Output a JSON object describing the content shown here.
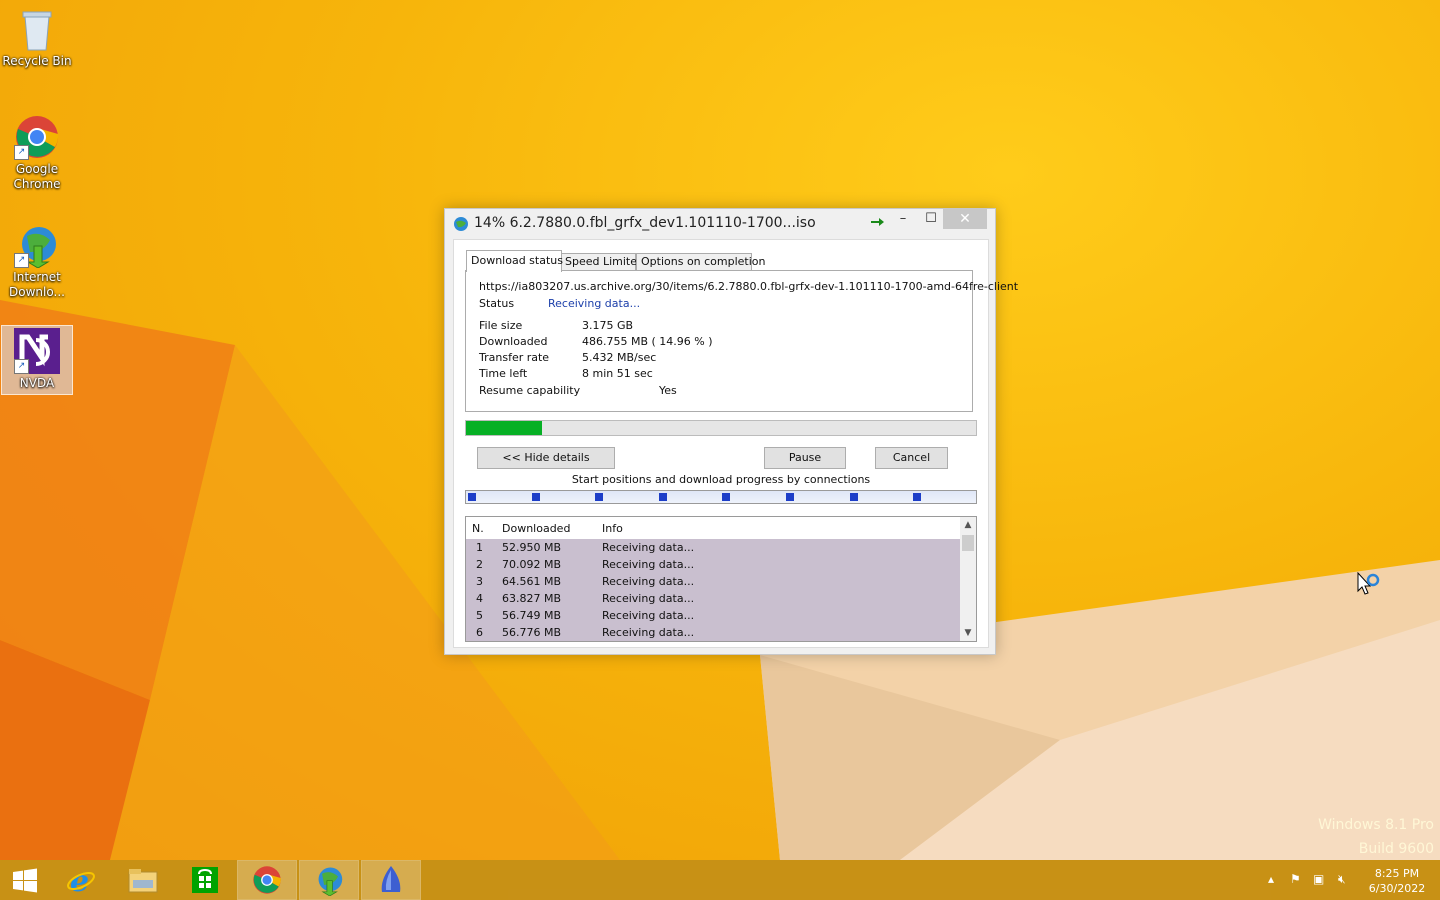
{
  "desktop": {
    "icons": [
      {
        "label": "Recycle Bin"
      },
      {
        "label": "Google Chrome"
      },
      {
        "label": "Internet Downlo..."
      },
      {
        "label": "NVDA"
      }
    ],
    "watermark": {
      "line1": "Windows 8.1 Pro",
      "line2": "Build 9600"
    }
  },
  "window": {
    "title": "14% 6.2.7880.0.fbl_grfx_dev1.101110-1700...iso",
    "tabs": [
      "Download status",
      "Speed Limiter",
      "Options on completion"
    ],
    "url": "https://ia803207.us.archive.org/30/items/6.2.7880.0.fbl-grfx-dev-1.101110-1700-amd-64fre-client",
    "status": {
      "label": "Status",
      "value": "Receiving data..."
    },
    "details": [
      {
        "label": "File size",
        "value": "3.175  GB"
      },
      {
        "label": "Downloaded",
        "value": "486.755  MB  ( 14.96 % )"
      },
      {
        "label": "Transfer rate",
        "value": "5.432  MB/sec"
      },
      {
        "label": "Time left",
        "value": "8 min 51 sec"
      },
      {
        "label": "Resume capability",
        "value": "Yes"
      }
    ],
    "progress_percent": 14.96,
    "buttons": {
      "hide_details": "<< Hide details",
      "pause": "Pause",
      "cancel": "Cancel"
    },
    "connections_caption": "Start positions and download progress by connections",
    "connections_count": 8,
    "table": {
      "columns": [
        "N.",
        "Downloaded",
        "Info"
      ],
      "rows": [
        {
          "n": "1",
          "downloaded": "52.950  MB",
          "info": "Receiving data..."
        },
        {
          "n": "2",
          "downloaded": "70.092  MB",
          "info": "Receiving data..."
        },
        {
          "n": "3",
          "downloaded": "64.561  MB",
          "info": "Receiving data..."
        },
        {
          "n": "4",
          "downloaded": "63.827  MB",
          "info": "Receiving data..."
        },
        {
          "n": "5",
          "downloaded": "56.749  MB",
          "info": "Receiving data..."
        },
        {
          "n": "6",
          "downloaded": "56.776  MB",
          "info": "Receiving data..."
        }
      ]
    }
  },
  "taskbar": {
    "items": [
      "start-button",
      "internet-explorer",
      "file-explorer",
      "store",
      "chrome",
      "internet-download-manager",
      "nvda"
    ],
    "clock": {
      "time": "8:25 PM",
      "date": "6/30/2022"
    }
  },
  "colors": {
    "progress": "#06b025",
    "connection_mark": "#1d3ec8",
    "row_selected": "#c9bfcf"
  }
}
